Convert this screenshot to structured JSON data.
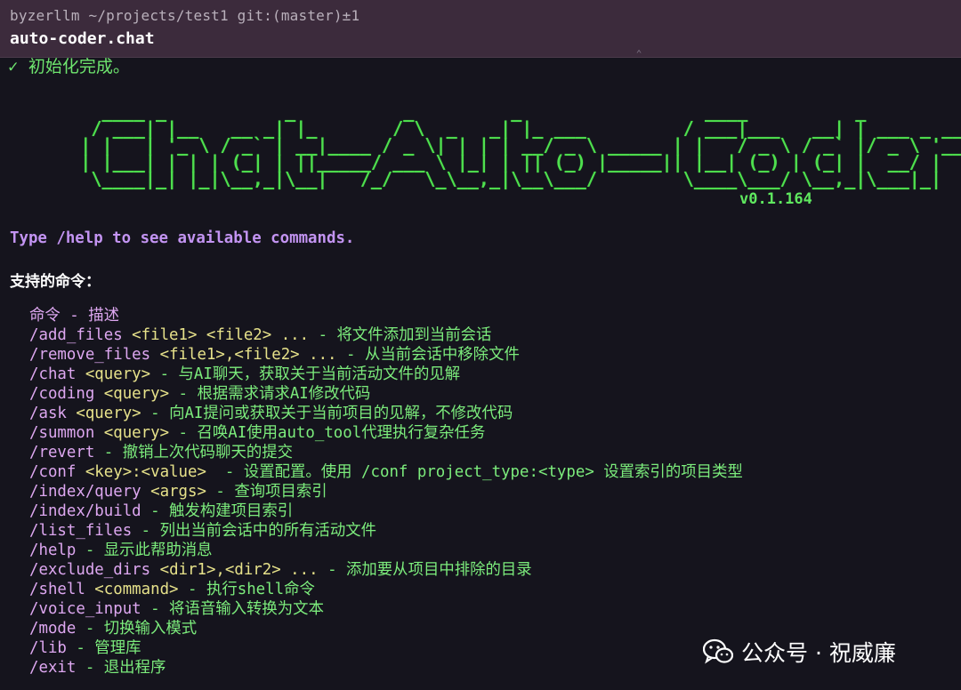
{
  "window": {
    "path_line": "byzerllm ~/projects/test1 git:(master)±1",
    "command_title": "auto-coder.chat",
    "collapse_glyph": "⌃"
  },
  "terminal": {
    "init_message": "✓ 初始化完成。",
    "banner_art": "     ____ _           _          _         _                 ____          _           \n    / ___| |__   __ _| |_       / \\  _   _| |_ ___         / ___|___   __| | ___ _ __ \n   | |   | '_ \\ / _` | __|____ / _ \\| | | | __/ _ \\ _____ | |   / _ \\ / _` |/ _ \\ '__|\n   | |___| | | | (_| | ||_____/ ___ \\ |_| | || (_) |_____|| |__| (_) | (_| |  __/ |   \n    \\____|_| |_|\\__,_|\\__|   /_/   \\_\\__,_|\\__\\___/        \\____\\___/ \\__,_|\\___|_|   ",
    "version": "v0.1.164",
    "help_hint": "Type /help to see available commands.",
    "supported_heading": "支持的命令：",
    "commands_header": "命令 - 描述",
    "commands": [
      {
        "name": "/add_files",
        "args": " <file1> <file2> ...",
        "desc": " - 将文件添加到当前会话"
      },
      {
        "name": "/remove_files",
        "args": " <file1>,<file2> ...",
        "desc": " - 从当前会话中移除文件"
      },
      {
        "name": "/chat",
        "args": " <query>",
        "desc": " - 与AI聊天，获取关于当前活动文件的见解"
      },
      {
        "name": "/coding",
        "args": " <query>",
        "desc": " - 根据需求请求AI修改代码"
      },
      {
        "name": "/ask",
        "args": " <query>",
        "desc": " - 向AI提问或获取关于当前项目的见解，不修改代码"
      },
      {
        "name": "/summon",
        "args": " <query>",
        "desc": " - 召唤AI使用auto_tool代理执行复杂任务"
      },
      {
        "name": "/revert",
        "args": "",
        "desc": " - 撤销上次代码聊天的提交"
      },
      {
        "name": "/conf",
        "args": " <key>:<value>",
        "desc": "  - 设置配置。使用 /conf project_type:<type> 设置索引的项目类型"
      },
      {
        "name": "/index/query",
        "args": " <args>",
        "desc": " - 查询项目索引"
      },
      {
        "name": "/index/build",
        "args": "",
        "desc": " - 触发构建项目索引"
      },
      {
        "name": "/list_files",
        "args": "",
        "desc": " - 列出当前会话中的所有活动文件"
      },
      {
        "name": "/help",
        "args": "",
        "desc": " - 显示此帮助消息"
      },
      {
        "name": "/exclude_dirs",
        "args": " <dir1>,<dir2> ...",
        "desc": " - 添加要从项目中排除的目录"
      },
      {
        "name": "/shell",
        "args": " <command>",
        "desc": " - 执行shell命令"
      },
      {
        "name": "/voice_input",
        "args": "",
        "desc": " - 将语音输入转换为文本"
      },
      {
        "name": "/mode",
        "args": "",
        "desc": " - 切换输入模式"
      },
      {
        "name": "/lib",
        "args": "",
        "desc": " - 管理库"
      },
      {
        "name": "/exit",
        "args": "",
        "desc": " - 退出程序"
      }
    ]
  },
  "watermark": {
    "icon": "wechat-icon",
    "text": "公众号 · 祝威廉"
  },
  "colors": {
    "background": "#15141d",
    "titlebar": "#3c2b3c",
    "banner_green": "#4fe04f",
    "command_purple": "#dda7f0",
    "args_yellow": "#e6e18a",
    "desc_green": "#7cec7c",
    "hint_purple": "#c394f2"
  }
}
